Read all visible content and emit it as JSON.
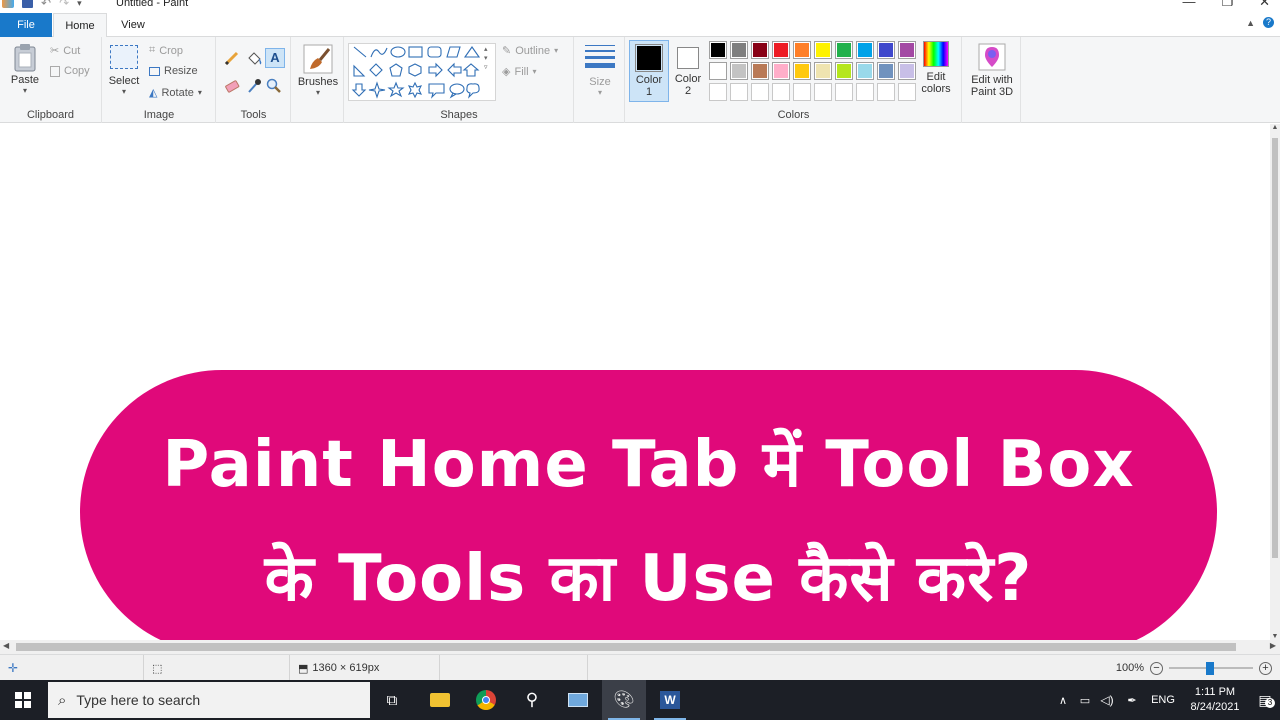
{
  "window": {
    "title": "Untitled - Paint",
    "controls": [
      "minimize",
      "restore",
      "close"
    ]
  },
  "tabs": {
    "file": "File",
    "home": "Home",
    "view": "View"
  },
  "ribbon": {
    "clipboard": {
      "label": "Clipboard",
      "paste": "Paste",
      "cut": "Cut",
      "copy": "Copy"
    },
    "image": {
      "label": "Image",
      "select": "Select",
      "crop": "Crop",
      "resize": "Resize",
      "rotate": "Rotate"
    },
    "tools": {
      "label": "Tools"
    },
    "brushes": {
      "label": "Brushes"
    },
    "shapes": {
      "label": "Shapes",
      "outline": "Outline",
      "fill": "Fill"
    },
    "size": {
      "label": "Size"
    },
    "colors": {
      "label": "Colors",
      "color1_line1": "Color",
      "color1_line2": "1",
      "color2_line1": "Color",
      "color2_line2": "2",
      "edit_line1": "Edit",
      "edit_line2": "colors",
      "paint3d_line1": "Edit with",
      "paint3d_line2": "Paint 3D",
      "color1_value": "#000000",
      "color2_value": "#ffffff",
      "palette_row1": [
        "#000000",
        "#7f7f7f",
        "#880015",
        "#ed1c24",
        "#ff7f27",
        "#fff200",
        "#22b14c",
        "#00a2e8",
        "#3f48cc",
        "#a349a4"
      ],
      "palette_row2": [
        "#ffffff",
        "#c3c3c3",
        "#b97a57",
        "#ffaec9",
        "#ffc90e",
        "#efe4b0",
        "#b5e61d",
        "#99d9ea",
        "#7092be",
        "#c8bfe7"
      ]
    }
  },
  "canvas": {
    "banner_color": "#e0097a",
    "line1": "Paint Home Tab में Tool Box",
    "line2": "के Tools का Use कैसे करे?"
  },
  "status": {
    "image_size": "1360 × 619px",
    "zoom": "100%"
  },
  "taskbar": {
    "search_placeholder": "Type here to search",
    "language": "ENG",
    "time": "1:11 PM",
    "date": "8/24/2021",
    "notifications": "3"
  }
}
